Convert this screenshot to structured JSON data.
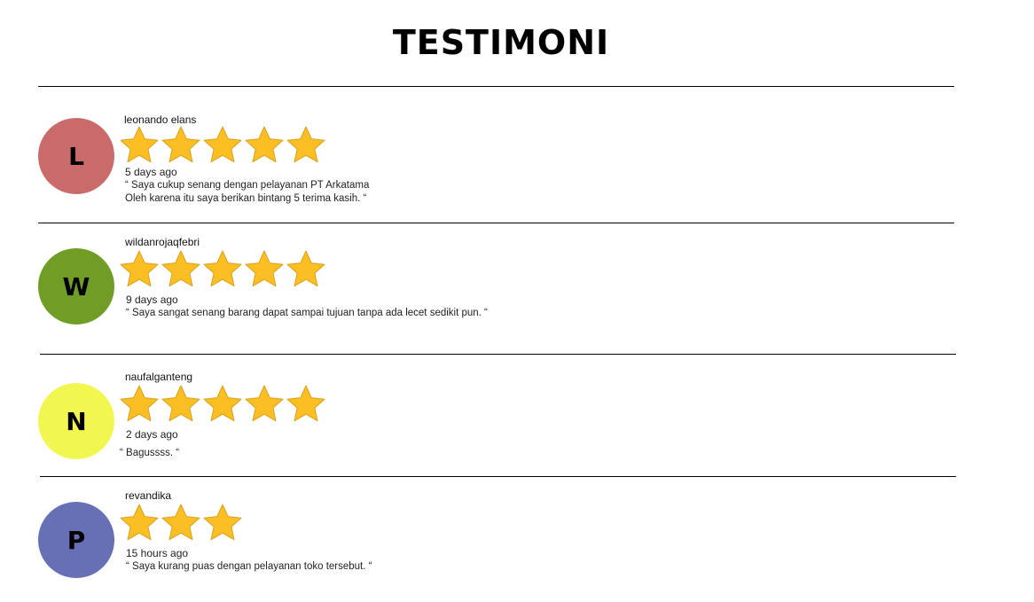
{
  "title": "TESTIMONI",
  "reviews": [
    {
      "initial": "L",
      "avatar_color": "#c96b6b",
      "name": "leonando elans",
      "rating": 5,
      "time": "5 days ago",
      "comment_line1": "“ Saya cukup senang dengan pelayanan PT Arkatama",
      "comment_line2": "Oleh karena itu saya berikan bintang 5 terima kasih. “"
    },
    {
      "initial": "W",
      "avatar_color": "#6f9d25",
      "name": "wildanrojaqfebri",
      "rating": 5,
      "time": "9 days ago",
      "comment_line1": "“ Saya sangat senang barang dapat sampai tujuan tanpa ada lecet sedikit pun. “"
    },
    {
      "initial": "N",
      "avatar_color": "#f2f750",
      "name": "naufalganteng",
      "rating": 5,
      "time": "2 days ago",
      "comment_line1": "“ Bagussss. “"
    },
    {
      "initial": "P",
      "avatar_color": "#6870b5",
      "name": "revandika",
      "rating": 3,
      "time": "15 hours ago",
      "comment_line1": "“ Saya kurang puas dengan pelayanan toko tersebut. “"
    }
  ],
  "star_color": "#fbbf24",
  "star_icon": "star-icon"
}
